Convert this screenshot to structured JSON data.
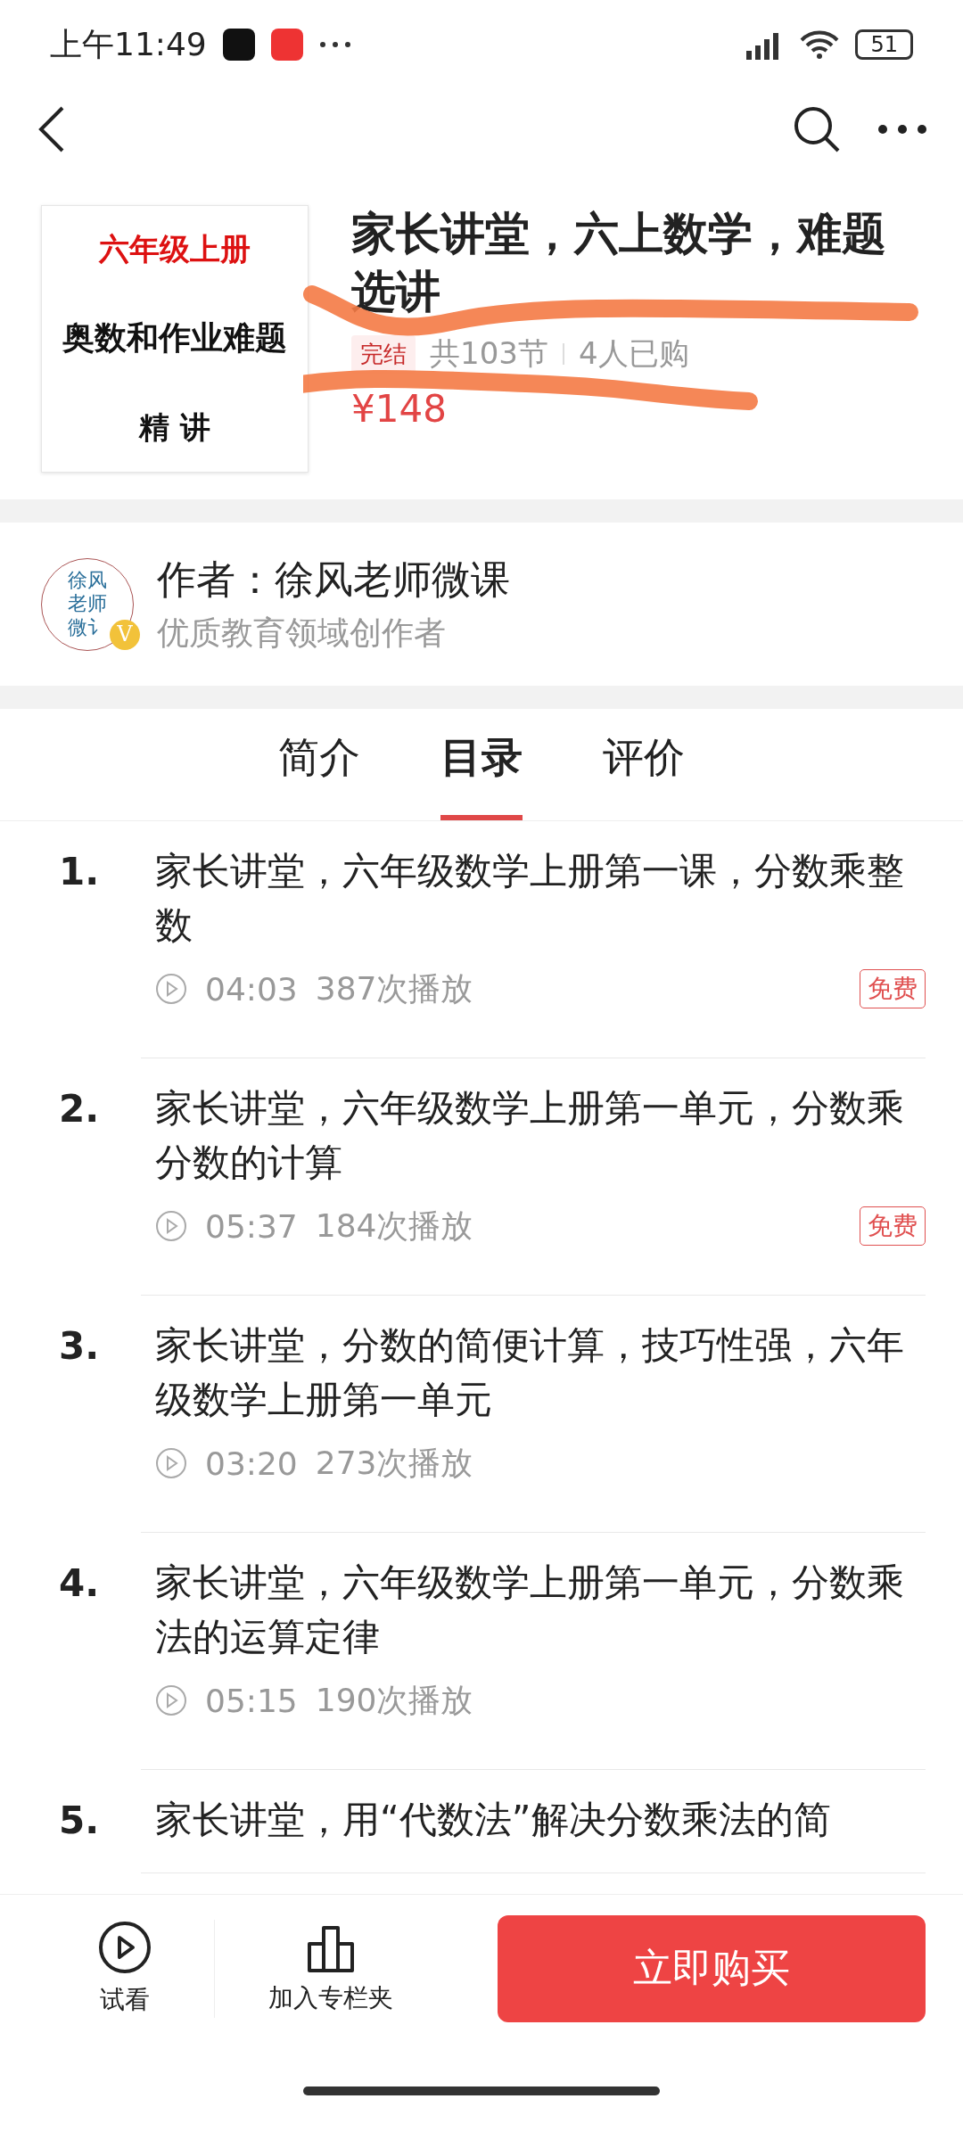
{
  "status_bar": {
    "time": "上午11:49",
    "battery": "51"
  },
  "course": {
    "cover_lines": [
      "六年级上册",
      "奥数和作业难题",
      "精 讲"
    ],
    "title": "家长讲堂，六上数学，难题选讲",
    "badge": "完结",
    "lessons": "共103节",
    "buyers": "4人已购",
    "price": "¥148",
    "scribbled": true
  },
  "author": {
    "avatar_lines": [
      "徐风",
      "老师",
      "微讠"
    ],
    "verified_badge": "V",
    "name": "作者：徐风老师微课",
    "subtitle": "优质教育领域创作者"
  },
  "tabs": [
    {
      "label": "简介",
      "selected": false
    },
    {
      "label": "目录",
      "selected": true
    },
    {
      "label": "评价",
      "selected": false
    }
  ],
  "lessons": [
    {
      "index": "1.",
      "title": "家长讲堂，六年级数学上册第一课，分数乘整数",
      "duration": "04:03",
      "plays": "387次播放",
      "tag": "免费"
    },
    {
      "index": "2.",
      "title": "家长讲堂，六年级数学上册第一单元，分数乘分数的计算",
      "duration": "05:37",
      "plays": "184次播放",
      "tag": "免费"
    },
    {
      "index": "3.",
      "title": "家长讲堂，分数的简便计算，技巧性强，六年级数学上册第一单元",
      "duration": "03:20",
      "plays": "273次播放"
    },
    {
      "index": "4.",
      "title": "家长讲堂，六年级数学上册第一单元，分数乘法的运算定律",
      "duration": "05:15",
      "plays": "190次播放"
    },
    {
      "index": "5.",
      "title": "家长讲堂，用“代数法”解决分数乘法的简"
    }
  ],
  "bottom_bar": {
    "preview": "试看",
    "collect": "加入专栏夹",
    "buy": "立即购买"
  }
}
